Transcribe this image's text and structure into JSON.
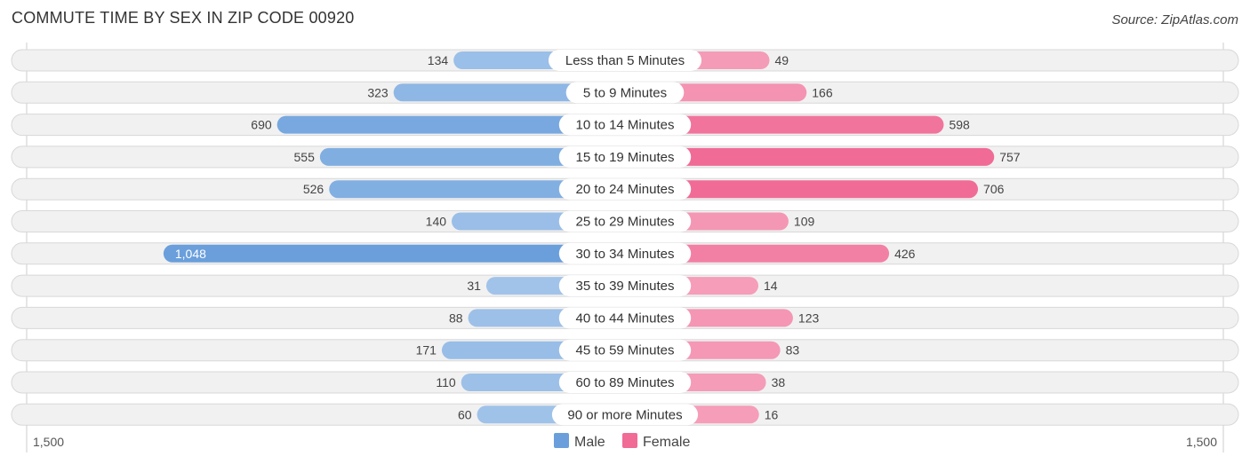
{
  "title": "COMMUTE TIME BY SEX IN ZIP CODE 00920",
  "source": "Source: ZipAtlas.com",
  "chart_data": {
    "type": "bar",
    "orientation": "horizontal-diverging",
    "title": "COMMUTE TIME BY SEX IN ZIP CODE 00920",
    "categories": [
      "Less than 5 Minutes",
      "5 to 9 Minutes",
      "10 to 14 Minutes",
      "15 to 19 Minutes",
      "20 to 24 Minutes",
      "25 to 29 Minutes",
      "30 to 34 Minutes",
      "35 to 39 Minutes",
      "40 to 44 Minutes",
      "45 to 59 Minutes",
      "60 to 89 Minutes",
      "90 or more Minutes"
    ],
    "series": [
      {
        "name": "Male",
        "color": "#6a9fdc",
        "values": [
          134,
          323,
          690,
          555,
          526,
          140,
          1048,
          31,
          88,
          171,
          110,
          60
        ]
      },
      {
        "name": "Female",
        "color": "#f06b96",
        "values": [
          49,
          166,
          598,
          757,
          706,
          109,
          426,
          14,
          123,
          83,
          38,
          16
        ]
      }
    ],
    "value_labels": {
      "male": [
        "134",
        "323",
        "690",
        "555",
        "526",
        "140",
        "1,048",
        "31",
        "88",
        "171",
        "110",
        "60"
      ],
      "female": [
        "49",
        "166",
        "598",
        "757",
        "706",
        "109",
        "426",
        "14",
        "123",
        "83",
        "38",
        "16"
      ]
    },
    "axis": {
      "left_label": "1,500",
      "right_label": "1,500",
      "range": [
        -1500,
        1500
      ]
    },
    "legend": {
      "position": "bottom-center",
      "items": [
        "Male",
        "Female"
      ]
    },
    "grid": false
  }
}
